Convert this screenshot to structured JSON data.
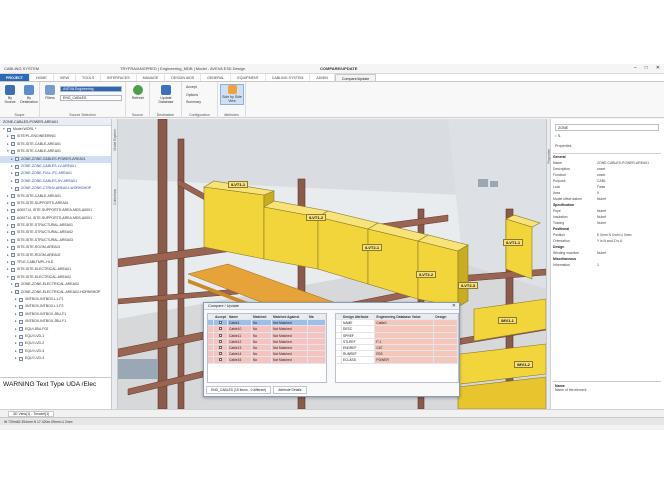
{
  "app": {
    "title": "TRYFRA/ANGPRED | Engineering_MDB | Model - AVEVA E3D Design",
    "context_tab": "COMPARE/UPDATE",
    "quick_access": "CABLING SYSTEM"
  },
  "tabs": [
    "PROJECT",
    "HOME",
    "VIEW",
    "TOOLS",
    "INTERFACES",
    "MANAGE",
    "DESIGN AIDS",
    "GENERAL",
    "EQUIPMENT",
    "CABLING SYSTEM",
    "ADMIN",
    "Compare/Update"
  ],
  "ribbon": {
    "by_source": "By Source",
    "by_destination": "By Destination",
    "scope_label": "Scope",
    "source_db": "AVEVA Engineering",
    "source_list": "ENG_CABLES",
    "filters": "Filters",
    "source_selection_label": "Source Selection",
    "refresh": "Refresh",
    "source_label": "Source",
    "update_database": "Update Database",
    "destination_label": "Destination",
    "accept": "Accept",
    "options": "Options",
    "summary": "Summary",
    "configuration_label": "Configuration",
    "side_by_side": "Side by Side View",
    "attributes_label": "Attributes"
  },
  "explorer": {
    "header": "ZONE-CABLES-POWER-AREA01",
    "rows": [
      {
        "label": "Model WORL *",
        "depth": 0,
        "tw": "▾"
      },
      {
        "label": "SITE/PL-ENGINEERING",
        "depth": 1,
        "tw": "▸"
      },
      {
        "label": "SITE-SITE-CABLE-AREA01",
        "depth": 1,
        "tw": "▸"
      },
      {
        "label": "SITE-SITE-CABLE-AREA01",
        "depth": 1,
        "tw": "▾"
      },
      {
        "label": "ZONE-ZONE-CABLES-POWER-AREA01",
        "depth": 2,
        "tw": "▸",
        "sel": true
      },
      {
        "label": "ZONE-ZONE-CABLES-LV-AREA01",
        "depth": 2,
        "tw": "▸",
        "hl": true
      },
      {
        "label": "ZONE-ZONE-FULL-PC-AREA01",
        "depth": 2,
        "tw": "▸",
        "hl": true
      },
      {
        "label": "ZONE-ZONE-CABLES-HV-AREA01",
        "depth": 2,
        "tw": "▸",
        "hl": true
      },
      {
        "label": "ZONE-ZONE-CTRHV-AREA01-WORKSHOP",
        "depth": 2,
        "tw": "▸",
        "hl": true
      },
      {
        "label": "SITE-SITE-CABLE-AREA01",
        "depth": 1,
        "tw": "▸"
      },
      {
        "label": "SITE-SITE-SUPPORTS-AREA01",
        "depth": 1,
        "tw": "▸"
      },
      {
        "label": "A000714, SITE-SUPPORTS-AREA-MDS-A0001",
        "depth": 1,
        "tw": "▸"
      },
      {
        "label": "A000714, SITE-SUPPORTS-AREA-MDS-A0001",
        "depth": 1,
        "tw": "▸"
      },
      {
        "label": "SITE-SITE-STRUCTURAL-AREA01",
        "depth": 1,
        "tw": "▸"
      },
      {
        "label": "SITE-SITE-STRUCTURAL-AREA02",
        "depth": 1,
        "tw": "▸"
      },
      {
        "label": "SITE-SITE-STRUCTURAL-AREA03",
        "depth": 1,
        "tw": "▸"
      },
      {
        "label": "SITE-SITE-ROOM-AREA01",
        "depth": 1,
        "tw": "▸"
      },
      {
        "label": "SITE-SITE-ROOM-AREA02",
        "depth": 1,
        "tw": "▸"
      },
      {
        "label": "TPLE-CABLTMPL-HLD",
        "depth": 1,
        "tw": "▸"
      },
      {
        "label": "SITE-SITE-ELECTRICAL-AREA01",
        "depth": 1,
        "tw": "▸"
      },
      {
        "label": "SITE-SITE-ELECTRICAL-AREA02",
        "depth": 1,
        "tw": "▾"
      },
      {
        "label": "ZONE-ZONE-ELECTRICAL-AREA02",
        "depth": 2,
        "tw": "▸"
      },
      {
        "label": "ZONE-ZONE-ELECTRICAL-AREA02-HORNSHOP",
        "depth": 2,
        "tw": "▸"
      },
      {
        "label": "/INTBOX-INTBOX-L1-F1",
        "depth": 3,
        "tw": "▸"
      },
      {
        "label": "/INTBOX-INTBOX-L1-F2",
        "depth": 3,
        "tw": "▸"
      },
      {
        "label": "/INTBOX-INTBOX-JBU-F1",
        "depth": 3,
        "tw": "▸"
      },
      {
        "label": "/INTBOX-INTBOX-JBU-F1",
        "depth": 3,
        "tw": "▸"
      },
      {
        "label": "EQUI JBU-F02",
        "depth": 3,
        "tw": "▸"
      },
      {
        "label": "EQUI LVD-1",
        "depth": 3,
        "tw": "▸"
      },
      {
        "label": "EQUI LVD-2",
        "depth": 3,
        "tw": "▸"
      },
      {
        "label": "EQUI LVD-3",
        "depth": 3,
        "tw": "▸"
      },
      {
        "label": "EQUI LVD-4",
        "depth": 3,
        "tw": "▸"
      }
    ]
  },
  "warning": "WARNING Text Type UDA /Elec",
  "viewport": {
    "tags": [
      "/LVT1-1",
      "/LVT1-2",
      "/LVT2-1",
      "/LVT2-2",
      "/LVT2-3",
      "/LVT1-1",
      "/MV1-1",
      "/MV1-2"
    ]
  },
  "properties": {
    "strip_label": "Properties",
    "selector": "ZONE",
    "header": "Properties",
    "rows": [
      {
        "k": "General",
        "v": "",
        "sect": true
      },
      {
        "k": "Name",
        "v": "ZONE-CABLES-POWER-AREA01"
      },
      {
        "k": "Description",
        "v": "unset"
      },
      {
        "k": "Function",
        "v": "unset"
      },
      {
        "k": "Purpose",
        "v": "CABL"
      },
      {
        "k": "Lock",
        "v": "False"
      },
      {
        "k": "Area",
        "v": "0"
      },
      {
        "k": "Model offset datum",
        "v": "Nulref"
      },
      {
        "k": "Specification",
        "v": "",
        "sect": true
      },
      {
        "k": "Pspe",
        "v": "Nulref"
      },
      {
        "k": "Insulation",
        "v": "Nulref"
      },
      {
        "k": "Tracing",
        "v": "Nulref"
      },
      {
        "k": "Positional",
        "v": "",
        "sect": true
      },
      {
        "k": "Position",
        "v": "E 0mm N 0mm U 0mm"
      },
      {
        "k": "Orientation",
        "v": "Y is N and Z is U"
      },
      {
        "k": "Design",
        "v": "",
        "sect": true
      },
      {
        "k": "Winding machine",
        "v": "Nulref"
      },
      {
        "k": "Miscellaneous",
        "v": "",
        "sect": true
      },
      {
        "k": "Information",
        "v": "1"
      }
    ],
    "desc_title": "Name",
    "desc_text": "Name of the element"
  },
  "bottom_tab": "3D View(1) - Tmodel(1)",
  "status": "W 730m62.394mm N 17.420m.05mm U 2mm",
  "dialog": {
    "title": "Compare / Update",
    "left_headers": [
      "",
      "Accept",
      "Name",
      "Matched",
      "Matched Against",
      "Ma"
    ],
    "left_rows": [
      {
        "name": "Cable1",
        "matched": "No",
        "against": "Not Matched",
        "cls": "rowsel"
      },
      {
        "name": "Cable10",
        "matched": "No",
        "against": "Not Matched",
        "cls": "rowred"
      },
      {
        "name": "Cable11",
        "matched": "No",
        "against": "Not Matched",
        "cls": "rowred"
      },
      {
        "name": "Cable12",
        "matched": "No",
        "against": "Not Matched",
        "cls": "rowred"
      },
      {
        "name": "Cable13",
        "matched": "No",
        "against": "Not Matched",
        "cls": "rowred"
      },
      {
        "name": "Cable14",
        "matched": "No",
        "against": "Not Matched",
        "cls": "rowred"
      },
      {
        "name": "Cable15",
        "matched": "No",
        "against": "Not Matched",
        "cls": "rowred"
      }
    ],
    "right_headers": [
      "",
      "Design Attribute",
      "Engineering Database Value",
      "Design"
    ],
    "right_rows": [
      {
        "attr": "NAME",
        "val": "Cable1"
      },
      {
        "attr": "DESC",
        "val": ""
      },
      {
        "attr": "SPREF",
        "val": ""
      },
      {
        "attr": "STLREF",
        "val": "F-1"
      },
      {
        "attr": "ENDREF",
        "val": "C67"
      },
      {
        "attr": "RUNREF",
        "val": "R03"
      },
      {
        "attr": "ECLASS",
        "val": "POWER"
      }
    ],
    "footer": [
      "ENG_CABLES (15 Items - 0 different)",
      "Attribute Details"
    ]
  }
}
